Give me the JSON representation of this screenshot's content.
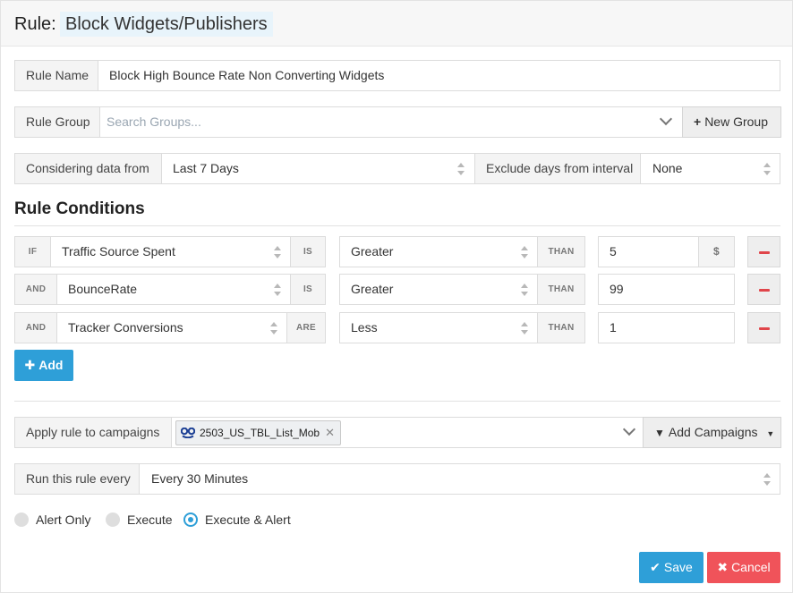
{
  "header": {
    "rule_label": "Rule:",
    "rule_type": "Block Widgets/Publishers"
  },
  "rule_name": {
    "label": "Rule Name",
    "value": "Block High Bounce Rate Non Converting Widgets"
  },
  "rule_group": {
    "label": "Rule Group",
    "placeholder": "Search Groups...",
    "new_group_label": "New Group"
  },
  "data_range": {
    "label": "Considering data from",
    "value": "Last 7 Days",
    "exclude_label": "Exclude days from interval",
    "exclude_value": "None"
  },
  "conditions": {
    "title": "Rule Conditions",
    "rows": [
      {
        "prefix": "IF",
        "metric": "Traffic Source Spent",
        "verb": "IS",
        "operator": "Greater",
        "than": "THAN",
        "value": "5",
        "unit": "$"
      },
      {
        "prefix": "AND",
        "metric": "BounceRate",
        "verb": "IS",
        "operator": "Greater",
        "than": "THAN",
        "value": "99"
      },
      {
        "prefix": "AND",
        "metric": "Tracker Conversions",
        "verb": "ARE",
        "operator": "Less",
        "than": "THAN",
        "value": "1"
      }
    ],
    "add_label": "Add"
  },
  "campaigns": {
    "label": "Apply rule to campaigns",
    "chip": "2503_US_TBL_List_Mob",
    "add_label": "Add Campaigns"
  },
  "schedule": {
    "label": "Run this rule every",
    "value": "Every 30 Minutes"
  },
  "modes": [
    {
      "label": "Alert Only",
      "selected": false
    },
    {
      "label": "Execute",
      "selected": false
    },
    {
      "label": "Execute & Alert",
      "selected": true
    }
  ],
  "actions": {
    "save_label": "Save",
    "cancel_label": "Cancel"
  },
  "colors": {
    "primary": "#2e9fd8",
    "danger": "#f0535a",
    "minus": "#e0454a"
  }
}
